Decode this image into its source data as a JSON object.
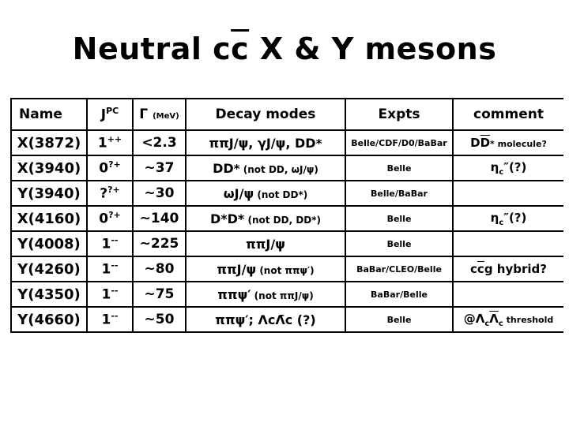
{
  "slide": {
    "title_parts": {
      "pre": "Neutral c",
      "cbar": "c",
      "post": " X & Y mesons"
    },
    "title_text": "Neutral cc̄ X & Y mesons"
  },
  "table": {
    "headers": {
      "name": "Name",
      "jpc_base": "J",
      "jpc_sup": "PC",
      "gamma_base": "Γ",
      "gamma_unit": "(MeV)",
      "decay": "Decay modes",
      "expts": "Expts",
      "comment": "comment"
    },
    "rows": [
      {
        "name": "X(3872)",
        "jpc_base": "1",
        "jpc_sup": "++",
        "gamma": "<2.3",
        "decay_main": "ππJ/ψ, γJ/ψ, DD",
        "decay_star": "*",
        "decay_note": "",
        "expts": "Belle/CDF/D0/BaBar",
        "comment_main": "DD",
        "comment_bar": "̄",
        "comment_rest": "* molecule?",
        "comment_text": "DD̄* molecule?"
      },
      {
        "name": "X(3940)",
        "jpc_base": "0",
        "jpc_sup": "?+",
        "gamma": "~37",
        "decay_main": "DD",
        "decay_star": "*",
        "decay_note": "(not DD, ωJ/ψ)",
        "expts": "Belle",
        "comment_text": "ηc″(?)",
        "comment_symbol": "η",
        "comment_sub": "c",
        "comment_tail": "″(?)"
      },
      {
        "name": "Y(3940)",
        "jpc_base": "?",
        "jpc_sup": "?+",
        "gamma": "~30",
        "decay_main": "ωJ/ψ",
        "decay_star": "",
        "decay_note": "(not DD*)",
        "expts": "Belle/BaBar",
        "comment_text": ""
      },
      {
        "name": "X(4160)",
        "jpc_base": "0",
        "jpc_sup": "?+",
        "gamma": "~140",
        "decay_main": "D*D*",
        "decay_star": "",
        "decay_note": "(not DD, DD*)",
        "expts": "Belle",
        "comment_text": "ηc″(?)",
        "comment_symbol": "η",
        "comment_sub": "c",
        "comment_tail": "″(?)"
      },
      {
        "name": "Y(4008)",
        "jpc_base": "1",
        "jpc_sup": "--",
        "gamma": "~225",
        "decay_main": "ππJ/ψ",
        "decay_star": "",
        "decay_note": "",
        "expts": "Belle",
        "comment_text": ""
      },
      {
        "name": "Y(4260)",
        "jpc_base": "1",
        "jpc_sup": "--",
        "gamma": "~80",
        "decay_main": "ππJ/ψ",
        "decay_star": "",
        "decay_note": "(not ππψ′)",
        "expts": "BaBar/CLEO/Belle",
        "comment_text": "cc̄g hybrid?",
        "comment_pre": "c",
        "comment_bar": "c",
        "comment_post": "g hybrid?"
      },
      {
        "name": "Y(4350)",
        "jpc_base": "1",
        "jpc_sup": "--",
        "gamma": "~75",
        "decay_main": "ππψ′",
        "decay_star": "",
        "decay_note": "(not ππJ/ψ)",
        "expts": "BaBar/Belle",
        "comment_text": ""
      },
      {
        "name": "Y(4660)",
        "jpc_base": "1",
        "jpc_sup": "--",
        "gamma": "~50",
        "decay_main": "ππψ′; ΛcΛ̄c (?)",
        "decay_star": "",
        "decay_note": "",
        "expts": "Belle",
        "comment_text": "@ΛcΛ̄c threshold"
      }
    ]
  }
}
